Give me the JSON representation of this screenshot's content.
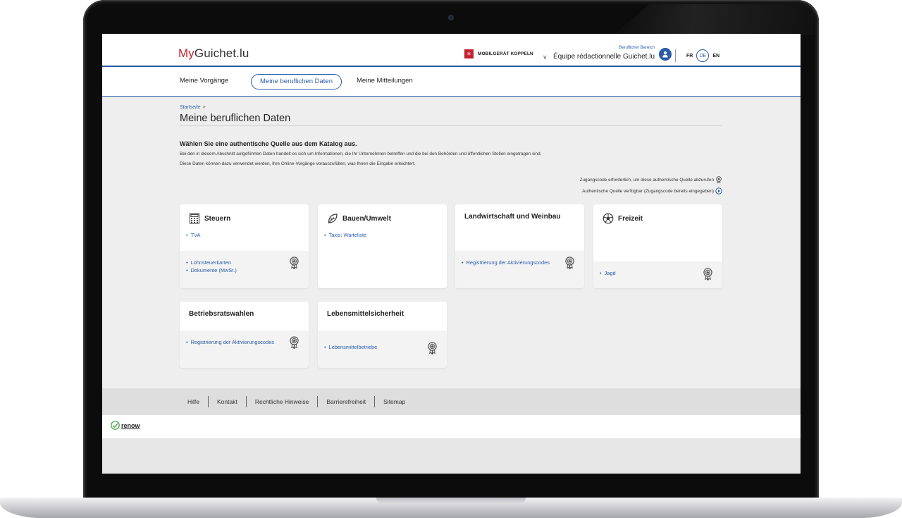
{
  "header": {
    "logo_prefix": "My",
    "logo_suffix": "Guichet.lu",
    "mobile_label": "MOBILGERÄT KOPPELN",
    "account_role": "Beruflicher Bereich",
    "account_name": "Équipe rédactionnelle Guichet.lu",
    "languages": [
      "FR",
      "DE",
      "EN"
    ],
    "active_language": "DE"
  },
  "nav": {
    "items": [
      "Meine Vorgänge",
      "Meine beruflichen Daten",
      "Meine Mitteilungen"
    ]
  },
  "breadcrumb": {
    "home": "Startseite",
    "separator": ">"
  },
  "page": {
    "title": "Meine beruflichen Daten",
    "intro_heading": "Wählen Sie eine authentische Quelle aus dem Katalog aus.",
    "intro_line1": "Bei den in diesem Abschnitt aufgeführten Daten handelt es sich um Informationen, die Ihr Unternehmen betreffen und die bei den Behörden und öffentlichen Stellen eingetragen sind.",
    "intro_line2": "Diese Daten können dazu verwendet werden, Ihre Online-Vorgänge vorauszufüllen, was Ihnen die Eingabe erleichtert.",
    "legend_code": "Zugangscode erforderlich, um diese authentische Quelle abzurufen",
    "legend_available": "Authentische Quelle verfügbar (Zugangscode bereits eingegeben)"
  },
  "cards": [
    {
      "title": "Steuern",
      "icon": "calculator-icon",
      "links": [
        "TVA"
      ],
      "locked_links": [
        "Lohnsteuerkarten",
        "Dokumente (MwSt.)"
      ]
    },
    {
      "title": "Bauen/Umwelt",
      "icon": "leaf-icon",
      "links": [
        "Taxis: Warteliste"
      ],
      "locked_links": []
    },
    {
      "title": "Landwirtschaft und Weinbau",
      "icon": "",
      "links": [],
      "locked_links": [
        "Registrierung der Aktivierungscodes"
      ]
    },
    {
      "title": "Freizeit",
      "icon": "football-icon",
      "links": [],
      "locked_links": [
        "Jagd"
      ]
    },
    {
      "title": "Betriebsratswahlen",
      "icon": "",
      "links": [],
      "locked_links": [
        "Registrierung der Aktivierungscodes"
      ]
    },
    {
      "title": "Lebensmittelsicherheit",
      "icon": "",
      "links": [],
      "locked_links": [
        "Lebensmittelbetriebe"
      ]
    }
  ],
  "footer": {
    "links": [
      "Hilfe",
      "Kontakt",
      "Rechtliche Hinweise",
      "Barrierefreiheit",
      "Sitemap"
    ],
    "brand": "renow"
  },
  "colors": {
    "accent": "#2a5ca8",
    "brand_red": "#c0212f",
    "background": "#eeeeee"
  }
}
